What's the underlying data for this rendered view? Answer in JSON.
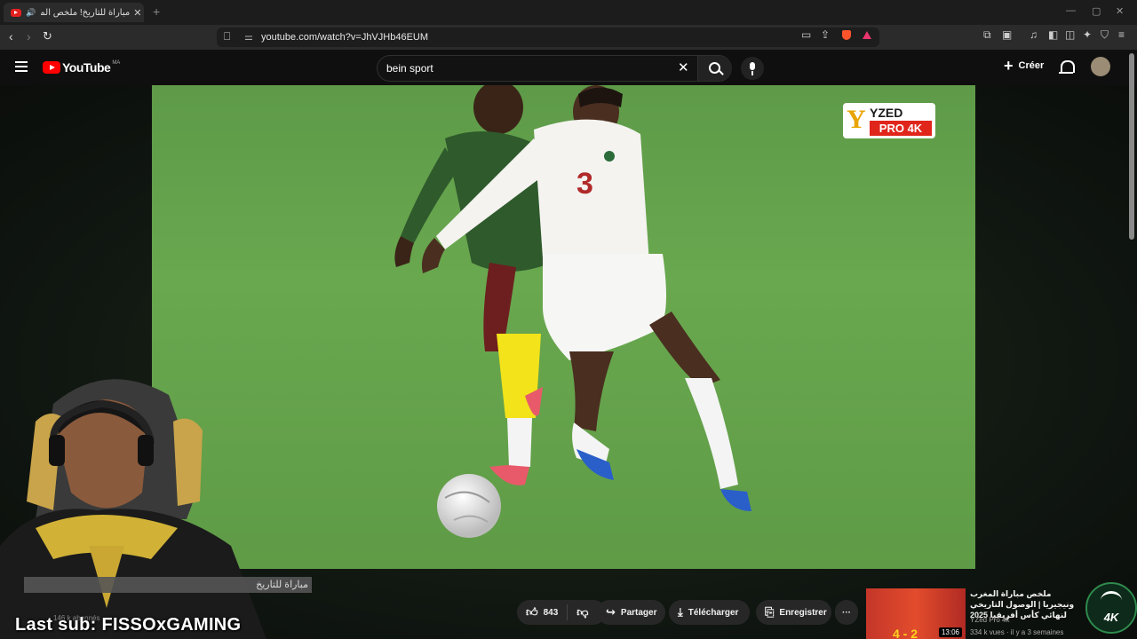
{
  "browser": {
    "tab_title": "مباراة للتاريخ! ملخص المغرب و",
    "new_tab_label": "+",
    "url": "youtube.com/watch?v=JhVJHb46EUM",
    "window_controls": [
      "—",
      "▢",
      "✕"
    ]
  },
  "youtube": {
    "logo_text": "YouTube",
    "country_code": "MA",
    "search_value": "bein sport",
    "create_label": "Créer"
  },
  "video": {
    "watermark_brand": "YZED",
    "watermark_sub": "PRO 4K",
    "jersey_number": "3",
    "title_overlay": "مباراة للتاريخ",
    "views_overlay": "146 k abonnés"
  },
  "stream": {
    "last_sub": "Last sub: FISSOxGAMING"
  },
  "actions": {
    "likes": "843",
    "share_label": "Partager",
    "download_label": "Télécharger",
    "save_label": "Enregistrer",
    "more_label": "···"
  },
  "recommended": {
    "title": "ملخص مباراة المغرب ونيجيريا | الوصول التاريخي لنهائي كأس أفريقيا 2025",
    "channel": "YZed Pro 4k",
    "meta": "334 k vues · il y a 3 semaines",
    "duration": "13:06",
    "score": "4 - 2"
  },
  "corner_logo": {
    "text": "4K"
  },
  "colors": {
    "youtube_red": "#ff0000",
    "pitch_green": "#66a44d",
    "pill_bg": "#272727"
  }
}
